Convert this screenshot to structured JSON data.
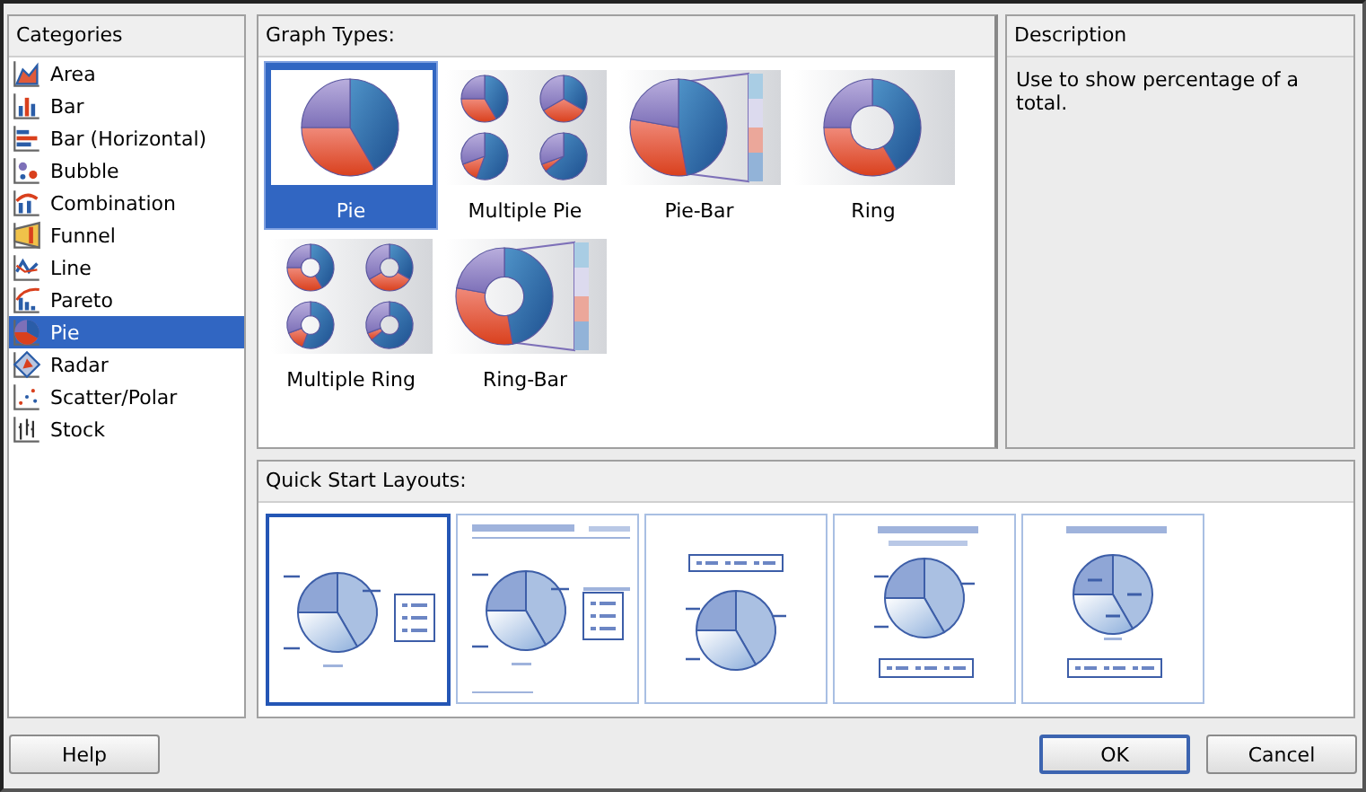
{
  "categories": {
    "label": "Categories",
    "items": [
      {
        "label": "Area",
        "selected": false
      },
      {
        "label": "Bar",
        "selected": false
      },
      {
        "label": "Bar (Horizontal)",
        "selected": false
      },
      {
        "label": "Bubble",
        "selected": false
      },
      {
        "label": "Combination",
        "selected": false
      },
      {
        "label": "Funnel",
        "selected": false
      },
      {
        "label": "Line",
        "selected": false
      },
      {
        "label": "Pareto",
        "selected": false
      },
      {
        "label": "Pie",
        "selected": true
      },
      {
        "label": "Radar",
        "selected": false
      },
      {
        "label": "Scatter/Polar",
        "selected": false
      },
      {
        "label": "Stock",
        "selected": false
      }
    ]
  },
  "graph_types": {
    "label": "Graph Types:",
    "items": [
      {
        "label": "Pie",
        "kind": "pie",
        "selected": true
      },
      {
        "label": "Multiple Pie",
        "kind": "multi-pie",
        "selected": false
      },
      {
        "label": "Pie-Bar",
        "kind": "pie-bar",
        "selected": false
      },
      {
        "label": "Ring",
        "kind": "ring",
        "selected": false
      },
      {
        "label": "Multiple Ring",
        "kind": "multi-ring",
        "selected": false
      },
      {
        "label": "Ring-Bar",
        "kind": "ring-bar",
        "selected": false
      }
    ]
  },
  "description": {
    "label": "Description",
    "text": "Use to show percentage of a total."
  },
  "quick_start": {
    "label": "Quick Start Layouts:",
    "layouts": [
      {
        "kind": "legend-right",
        "selected": true
      },
      {
        "kind": "titled-legend-right",
        "selected": false
      },
      {
        "kind": "legend-top",
        "selected": false
      },
      {
        "kind": "titled-legend-bottom",
        "selected": false
      },
      {
        "kind": "title-labels-legend-bottom",
        "selected": false
      }
    ]
  },
  "buttons": [
    {
      "label": "Help",
      "focused": false
    },
    {
      "label": "OK",
      "focused": true
    },
    {
      "label": "Cancel",
      "focused": false
    }
  ]
}
